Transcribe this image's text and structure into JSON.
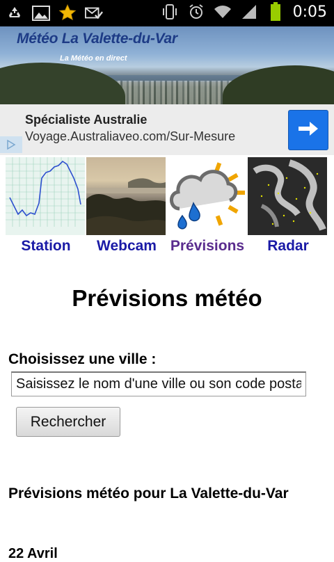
{
  "status_bar": {
    "time": "0:05",
    "icons": [
      "recycle-icon",
      "image-icon",
      "star-icon",
      "mail-check-icon",
      "vibrate-icon",
      "alarm-icon",
      "wifi-icon",
      "signal-icon",
      "battery-icon"
    ],
    "battery_color": "#99cc00",
    "star_color": "#f2b705"
  },
  "banner": {
    "title": "Météo La Valette-du-Var",
    "subtitle": "La Météo en direct",
    "title_color": "#1d3b86"
  },
  "ad": {
    "title": "Spécialiste Australie",
    "url": "Voyage.Australiaveo.com/Sur-Mesure",
    "button_icon": "arrow-right-icon",
    "button_color": "#1a73e8"
  },
  "nav": {
    "items": [
      {
        "label": "Station",
        "icon": "station-chart-thumbnail"
      },
      {
        "label": "Webcam",
        "icon": "webcam-thumbnail"
      },
      {
        "label": "Prévisions",
        "icon": "forecast-weather-thumbnail"
      },
      {
        "label": "Radar",
        "icon": "radar-thumbnail"
      }
    ],
    "link_color": "#1a1aa6",
    "visited_color": "#5a2c8e"
  },
  "main": {
    "heading": "Prévisions météo",
    "city_label": "Choisissez une ville :",
    "city_placeholder": "Saisissez le nom d'une ville ou son code postal",
    "search_button": "Rechercher",
    "section_title": "Prévisions météo pour La Valette-du-Var",
    "date": "22 Avril"
  }
}
